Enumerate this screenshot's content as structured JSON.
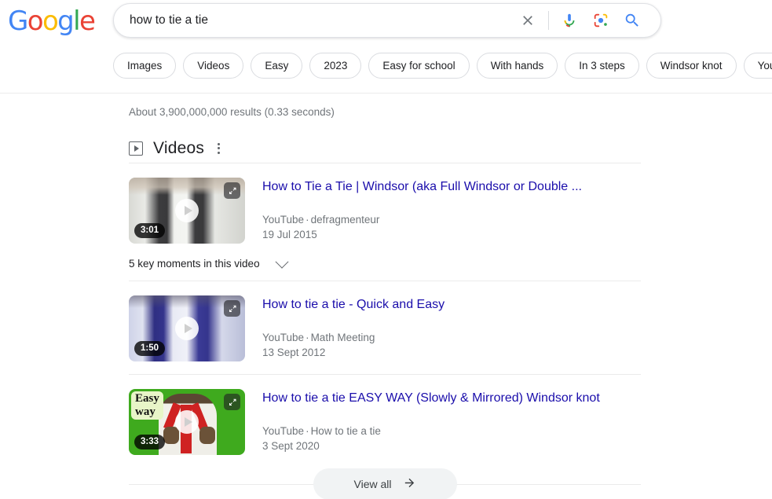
{
  "header": {
    "logo": {
      "letters": [
        "G",
        "o",
        "o",
        "g",
        "l",
        "e"
      ],
      "name": "google-logo"
    },
    "search": {
      "value": "how to tie a tie",
      "placeholder": "Search",
      "clear_label": "Clear",
      "voice_label": "Search by voice",
      "lens_label": "Search by image",
      "submit_label": "Google Search"
    },
    "chips": [
      {
        "label": "Images"
      },
      {
        "label": "Videos"
      },
      {
        "label": "Easy"
      },
      {
        "label": "2023"
      },
      {
        "label": "Easy for school"
      },
      {
        "label": "With hands"
      },
      {
        "label": "In 3 steps"
      },
      {
        "label": "Windsor knot"
      },
      {
        "label": "Youtube"
      }
    ]
  },
  "main": {
    "result_stats": "About 3,900,000,000 results (0.33 seconds)",
    "videos_section": {
      "title": "Videos",
      "menu_label": "More options",
      "view_all_label": "View all",
      "items": [
        {
          "title": "How to Tie a Tie | Windsor (aka Full Windsor or Double ...",
          "source": "YouTube",
          "separator": "·",
          "channel": "defragmenteur",
          "date": "19 Jul 2015",
          "duration": "3:01",
          "key_moments": "5 key moments in this video"
        },
        {
          "title": "How to tie a tie - Quick and Easy",
          "source": "YouTube",
          "separator": "·",
          "channel": "Math Meeting",
          "date": "13 Sept 2012",
          "duration": "1:50"
        },
        {
          "title": "How to tie a tie EASY WAY (Slowly & Mirrored) Windsor knot",
          "source": "YouTube",
          "separator": "·",
          "channel": "How to tie a tie",
          "date": "3 Sept 2020",
          "duration": "3:33",
          "thumbnail_overlay_line1": "Easy",
          "thumbnail_overlay_line2": "way"
        }
      ]
    }
  },
  "colors": {
    "link": "#1a0dab",
    "meta": "#70757a",
    "chip_border": "#dadce0",
    "accent_blue": "#4285f4",
    "accent_red": "#ea4335",
    "accent_yellow": "#fbbc05",
    "accent_green": "#34a853"
  }
}
